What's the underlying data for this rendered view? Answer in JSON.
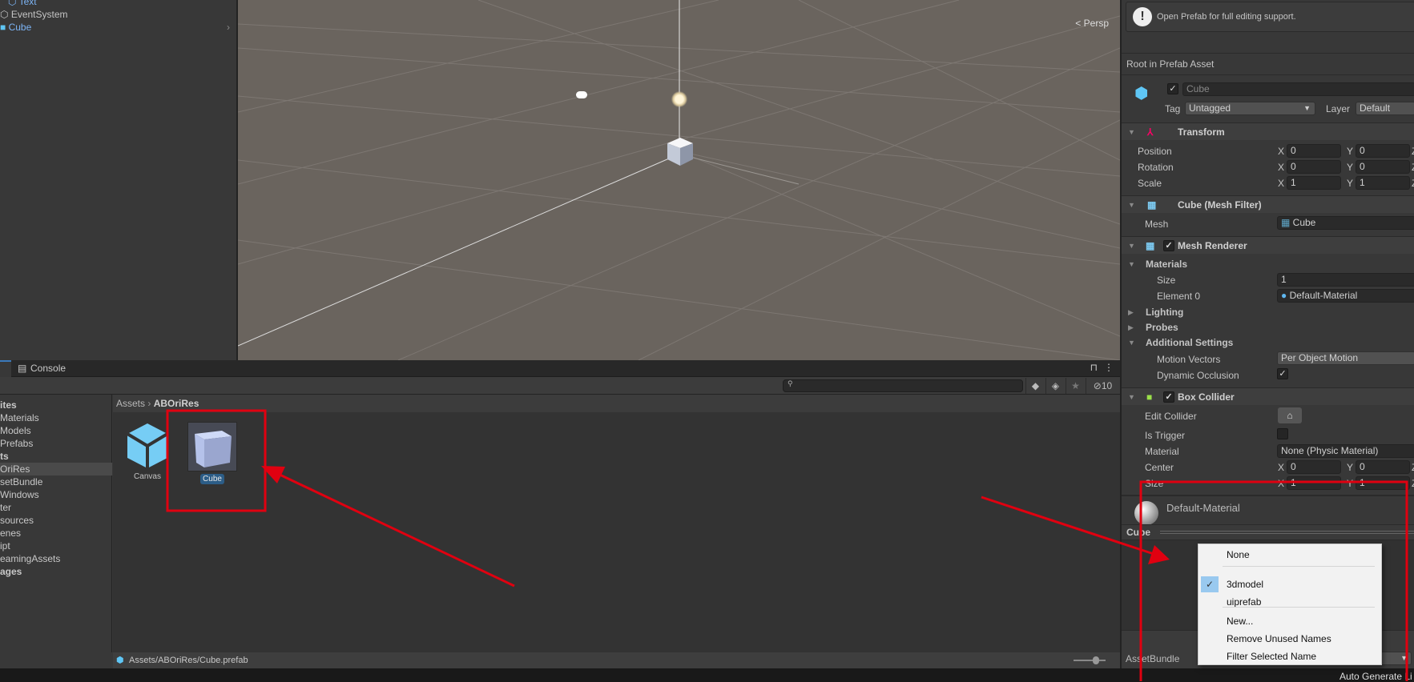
{
  "hierarchy": {
    "items": [
      {
        "label": "Text",
        "color": "#7cb4f5"
      },
      {
        "label": "EventSystem",
        "color": "#c4c4c4"
      },
      {
        "label": "Cube",
        "color": "#7cb4f5"
      }
    ]
  },
  "scene": {
    "view_mode": "Persp"
  },
  "project": {
    "tabs": {
      "console": "Console"
    },
    "hidden_count": "10",
    "sidebar": [
      {
        "label": "ites",
        "bold": true
      },
      {
        "label": "Materials"
      },
      {
        "label": "Models"
      },
      {
        "label": "Prefabs"
      },
      {
        "label": "ts",
        "bold": true
      },
      {
        "label": "OriRes",
        "selected": true
      },
      {
        "label": "setBundle"
      },
      {
        "label": "Windows"
      },
      {
        "label": "ter"
      },
      {
        "label": "sources"
      },
      {
        "label": "enes"
      },
      {
        "label": "ipt"
      },
      {
        "label": "eamingAssets"
      },
      {
        "label": "ages",
        "bold": true
      }
    ],
    "breadcrumb": {
      "root": "Assets",
      "current": "ABOriRes"
    },
    "assets": [
      {
        "label": "Canvas"
      },
      {
        "label": "Cube",
        "selected": true
      }
    ],
    "status_path": "Assets/ABOriRes/Cube.prefab"
  },
  "inspector": {
    "notice": "Open Prefab for full editing support.",
    "root_label": "Root in Prefab Asset",
    "object": {
      "name": "Cube",
      "active": true,
      "tag_label": "Tag",
      "tag": "Untagged",
      "layer_label": "Layer",
      "layer": "Default"
    },
    "transform": {
      "title": "Transform",
      "rows": [
        {
          "label": "Position",
          "x": "0",
          "y": "0"
        },
        {
          "label": "Rotation",
          "x": "0",
          "y": "0"
        },
        {
          "label": "Scale",
          "x": "1",
          "y": "1"
        }
      ]
    },
    "mesh_filter": {
      "title": "Cube (Mesh Filter)",
      "mesh_label": "Mesh",
      "mesh": "Cube"
    },
    "mesh_renderer": {
      "title": "Mesh Renderer",
      "materials": "Materials",
      "size_label": "Size",
      "size": "1",
      "element_label": "Element 0",
      "element": "Default-Material",
      "lighting": "Lighting",
      "probes": "Probes",
      "additional": "Additional Settings",
      "motion_label": "Motion Vectors",
      "motion": "Per Object Motion",
      "occlusion_label": "Dynamic Occlusion"
    },
    "box_collider": {
      "title": "Box Collider",
      "edit_label": "Edit Collider",
      "trigger_label": "Is Trigger",
      "material_label": "Material",
      "material": "None (Physic Material)",
      "center_label": "Center",
      "center_x": "0",
      "center_y": "0",
      "size_label": "Size",
      "size_x": "1",
      "size_y": "1"
    },
    "material_preview": "Default-Material",
    "preview_title": "Cube",
    "assetbundle_label": "AssetBundle",
    "auto_generate": "Auto Generate Li"
  },
  "dropdown": {
    "items": [
      "None",
      "3dmodel",
      "uiprefab",
      "New...",
      "Remove Unused Names",
      "Filter Selected Name"
    ],
    "checked": "3dmodel"
  },
  "colors": {
    "annotation": "#e00010",
    "selection": "#2c5d87",
    "check_highlight": "#99c9ef"
  }
}
